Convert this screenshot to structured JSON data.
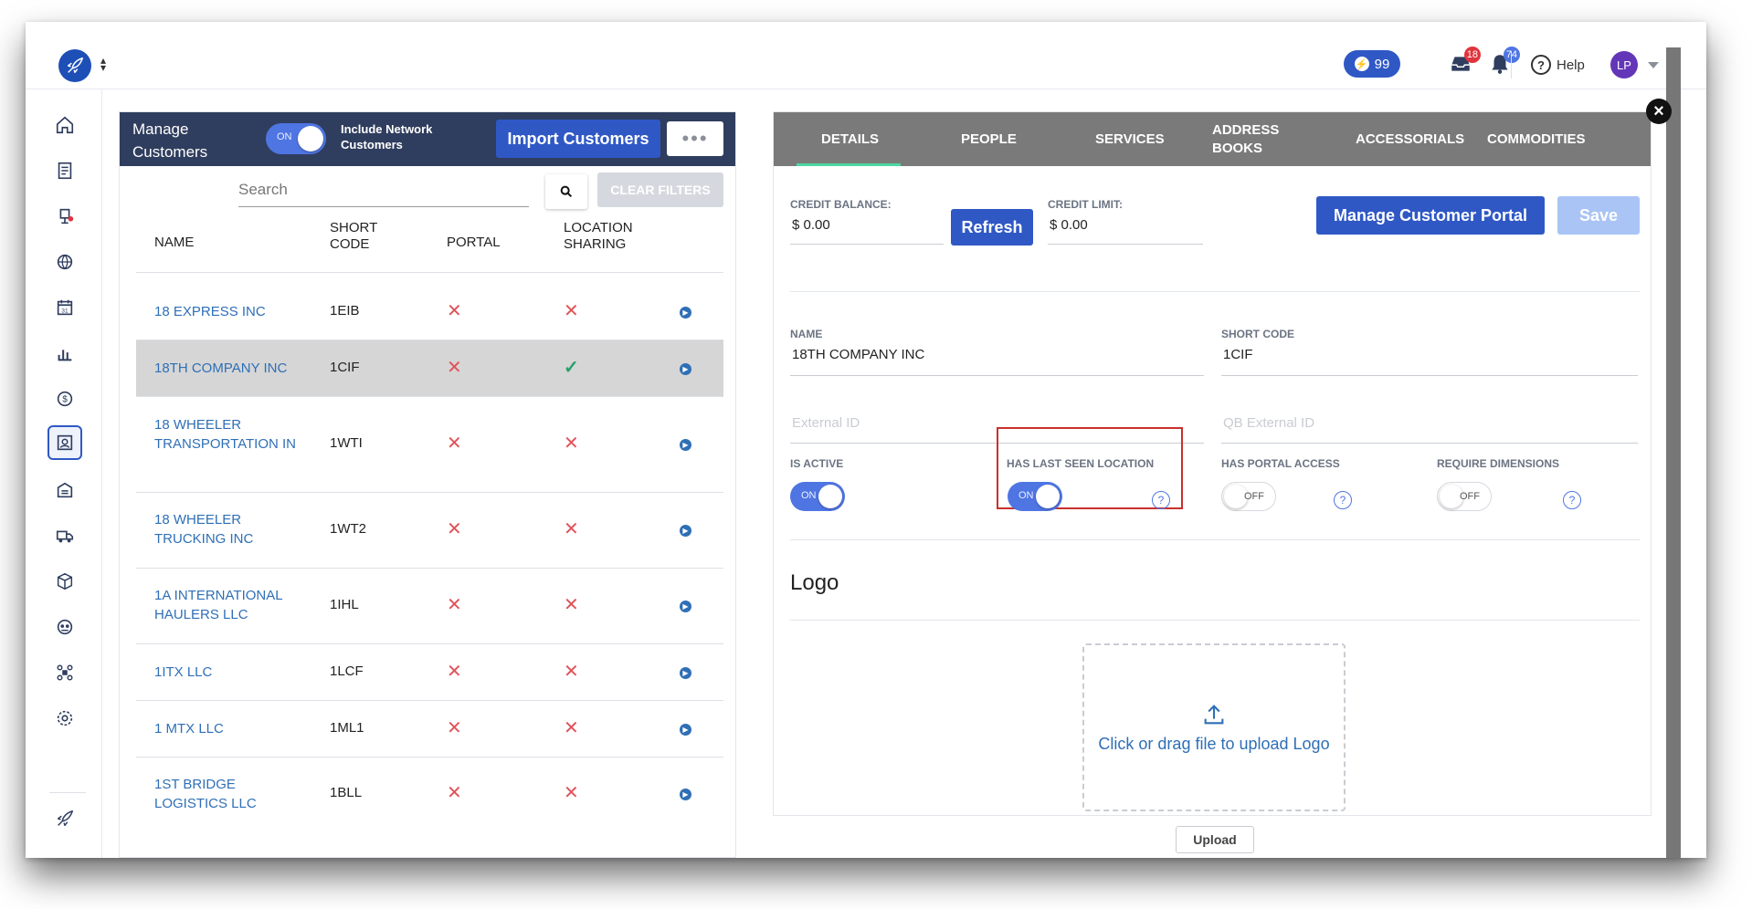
{
  "topbar": {
    "ticket_count": "99",
    "inbox_badge": "18",
    "notif_badge": "74",
    "help_label": "Help",
    "avatar_initials": "LP",
    "colors": {
      "brand_blue": "#2f58c5",
      "badge_red": "#e0343d",
      "avatar_purple": "#6336b8"
    }
  },
  "sidebar": {
    "icons": [
      "home-icon",
      "document-icon",
      "dispatch-icon",
      "globe-icon",
      "calendar-icon",
      "chart-icon",
      "dollar-icon",
      "customers-icon",
      "warehouse-icon",
      "truck-icon",
      "package-icon",
      "driver-icon",
      "network-icon",
      "gear-icon"
    ],
    "active": "customers-icon"
  },
  "left_panel": {
    "title": "Manage Customers",
    "network_toggle": {
      "state": "ON",
      "label": "Include Network Customers"
    },
    "import_button": "Import Customers",
    "more_button": "•••",
    "search_placeholder": "Search",
    "clear_filters": "CLEAR FILTERS",
    "columns": {
      "name": "NAME",
      "short_code": "SHORT CODE",
      "portal": "PORTAL",
      "location_sharing": "LOCATION SHARING"
    },
    "rows": [
      {
        "name": "18 EXPRESS INC",
        "code": "1EIB",
        "portal": false,
        "sharing": false,
        "selected": false
      },
      {
        "name": "18TH COMPANY INC",
        "code": "1CIF",
        "portal": false,
        "sharing": true,
        "selected": true
      },
      {
        "name": "18 WHEELER TRANSPORTATION IN",
        "code": "1WTI",
        "portal": false,
        "sharing": false,
        "selected": false
      },
      {
        "name": "18 WHEELER TRUCKING INC",
        "code": "1WT2",
        "portal": false,
        "sharing": false,
        "selected": false
      },
      {
        "name": "1A INTERNATIONAL HAULERS LLC",
        "code": "1IHL",
        "portal": false,
        "sharing": false,
        "selected": false
      },
      {
        "name": "1ITX LLC",
        "code": "1LCF",
        "portal": false,
        "sharing": false,
        "selected": false
      },
      {
        "name": "1 MTX LLC",
        "code": "1ML1",
        "portal": false,
        "sharing": false,
        "selected": false
      },
      {
        "name": "1ST BRIDGE LOGISTICS LLC",
        "code": "1BLL",
        "portal": false,
        "sharing": false,
        "selected": false
      }
    ]
  },
  "right_panel": {
    "tabs": [
      "DETAILS",
      "PEOPLE",
      "SERVICES",
      "ADDRESS BOOKS",
      "ACCESSORIALS",
      "COMMODITIES"
    ],
    "active_tab": "DETAILS",
    "credit_balance_label": "CREDIT BALANCE:",
    "credit_balance_value": "$ 0.00",
    "refresh_button": "Refresh",
    "credit_limit_label": "CREDIT LIMIT:",
    "credit_limit_value": "$ 0.00",
    "manage_portal_button": "Manage Customer Portal",
    "save_button": "Save",
    "name_label": "NAME",
    "name_value": "18TH COMPANY INC",
    "short_code_label": "SHORT CODE",
    "short_code_value": "1CIF",
    "external_id_placeholder": "External ID",
    "qb_external_id_placeholder": "QB External ID",
    "is_active_label": "IS ACTIVE",
    "is_active_state": "ON",
    "has_last_seen_label": "HAS LAST SEEN LOCATION",
    "has_last_seen_state": "ON",
    "has_portal_label": "HAS PORTAL ACCESS",
    "has_portal_state": "OFF",
    "require_dims_label": "REQUIRE DIMENSIONS",
    "require_dims_state": "OFF",
    "help_glyph": "?",
    "logo_title": "Logo",
    "upload_text": "Click or drag file to upload Logo",
    "upload_button": "Upload"
  }
}
